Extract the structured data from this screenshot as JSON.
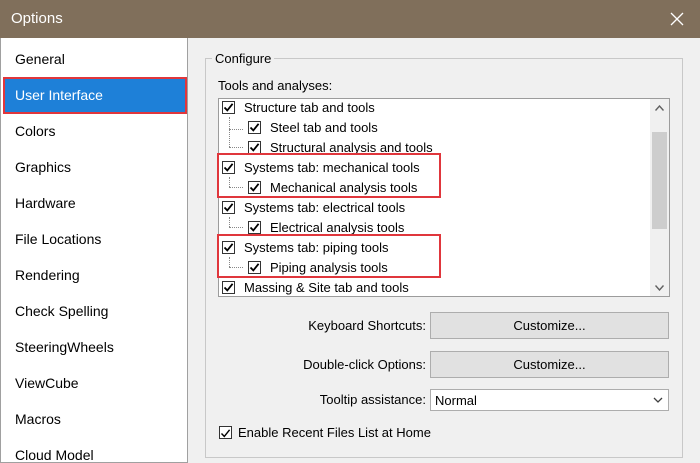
{
  "window": {
    "title": "Options",
    "close_icon": "close-icon"
  },
  "categories": [
    "General",
    "User Interface",
    "Colors",
    "Graphics",
    "Hardware",
    "File Locations",
    "Rendering",
    "Check Spelling",
    "SteeringWheels",
    "ViewCube",
    "Macros",
    "Cloud Model"
  ],
  "selected_category": "User Interface",
  "configure": {
    "legend": "Configure",
    "tools_label": "Tools and analyses:",
    "tree": [
      {
        "label": "Structure tab and tools",
        "checked": true,
        "level": 0
      },
      {
        "label": "Steel tab and tools",
        "checked": true,
        "level": 1
      },
      {
        "label": "Structural analysis and tools",
        "checked": true,
        "level": 1
      },
      {
        "label": "Systems tab: mechanical tools",
        "checked": true,
        "level": 0
      },
      {
        "label": "Mechanical analysis tools",
        "checked": true,
        "level": 1
      },
      {
        "label": "Systems tab: electrical tools",
        "checked": true,
        "level": 0
      },
      {
        "label": "Electrical analysis tools",
        "checked": true,
        "level": 1
      },
      {
        "label": "Systems tab: piping tools",
        "checked": true,
        "level": 0
      },
      {
        "label": "Piping analysis tools",
        "checked": true,
        "level": 1
      },
      {
        "label": "Massing & Site tab and tools",
        "checked": true,
        "level": 0
      }
    ],
    "keyboard_shortcuts": {
      "label": "Keyboard Shortcuts:",
      "button": "Customize..."
    },
    "double_click": {
      "label": "Double-click Options:",
      "button": "Customize..."
    },
    "tooltip": {
      "label": "Tooltip assistance:",
      "value": "Normal"
    },
    "recent_files": {
      "label": "Enable Recent Files List at Home",
      "checked": true
    }
  },
  "colors": {
    "titlebar": "#806f5b",
    "selection": "#1e80d8",
    "highlight_box": "#e0363c"
  }
}
